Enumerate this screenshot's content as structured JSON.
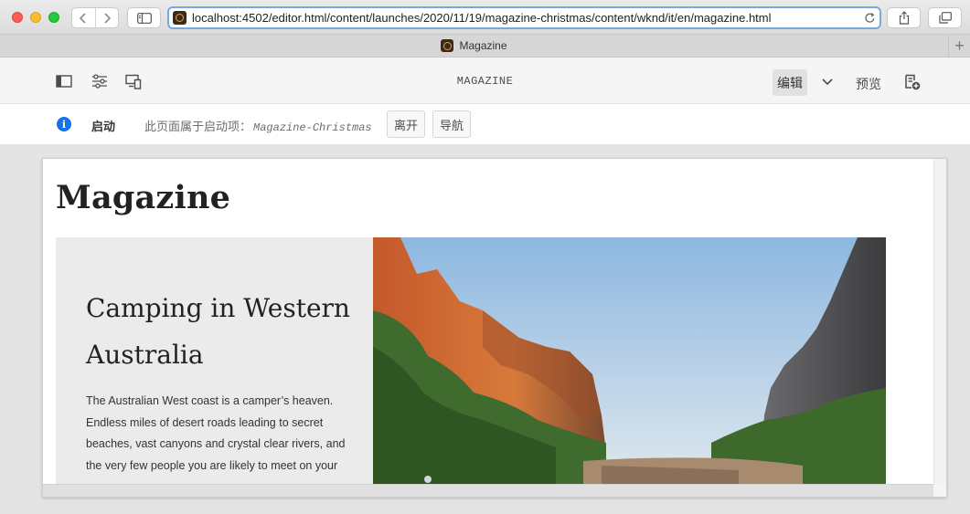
{
  "browser": {
    "url": "localhost:4502/editor.html/content/launches/2020/11/19/magazine-christmas/content/wknd/it/en/magazine.html",
    "tab_title": "Magazine",
    "new_tab_glyph": "+"
  },
  "icons": {
    "back": "chevron-left-icon",
    "forward": "chevron-right-icon",
    "sidebar": "sidebar-icon",
    "reload": "reload-icon",
    "share": "share-icon",
    "tabs": "tabs-overview-icon",
    "side_panel": "side-panel-icon",
    "page_properties": "page-properties-icon",
    "emulator": "emulator-icon",
    "publish": "publish-icon",
    "info": "info-icon"
  },
  "editor": {
    "page_title": "MAGAZINE",
    "edit_label": "编辑",
    "preview_label": "预览"
  },
  "launch": {
    "info_glyph": "i",
    "label": "启动",
    "description": "此页面属于启动项：",
    "launch_name": "Magazine-Christmas",
    "leave_label": "离开",
    "navigate_label": "导航"
  },
  "page": {
    "heading": "Magazine",
    "teaser": {
      "title": "Camping in Western Australia",
      "body": "The Australian West coast is a camper’s heaven. Endless miles of desert roads leading to secret beaches, vast canyons and crystal clear rivers, and the very few people you are likely to meet on your"
    }
  },
  "colors": {
    "accent_blue": "#1473e6",
    "address_focus": "#7aa6e6",
    "canvas_bg": "#e4e4e4",
    "toolbar_bg": "#f5f5f5"
  }
}
